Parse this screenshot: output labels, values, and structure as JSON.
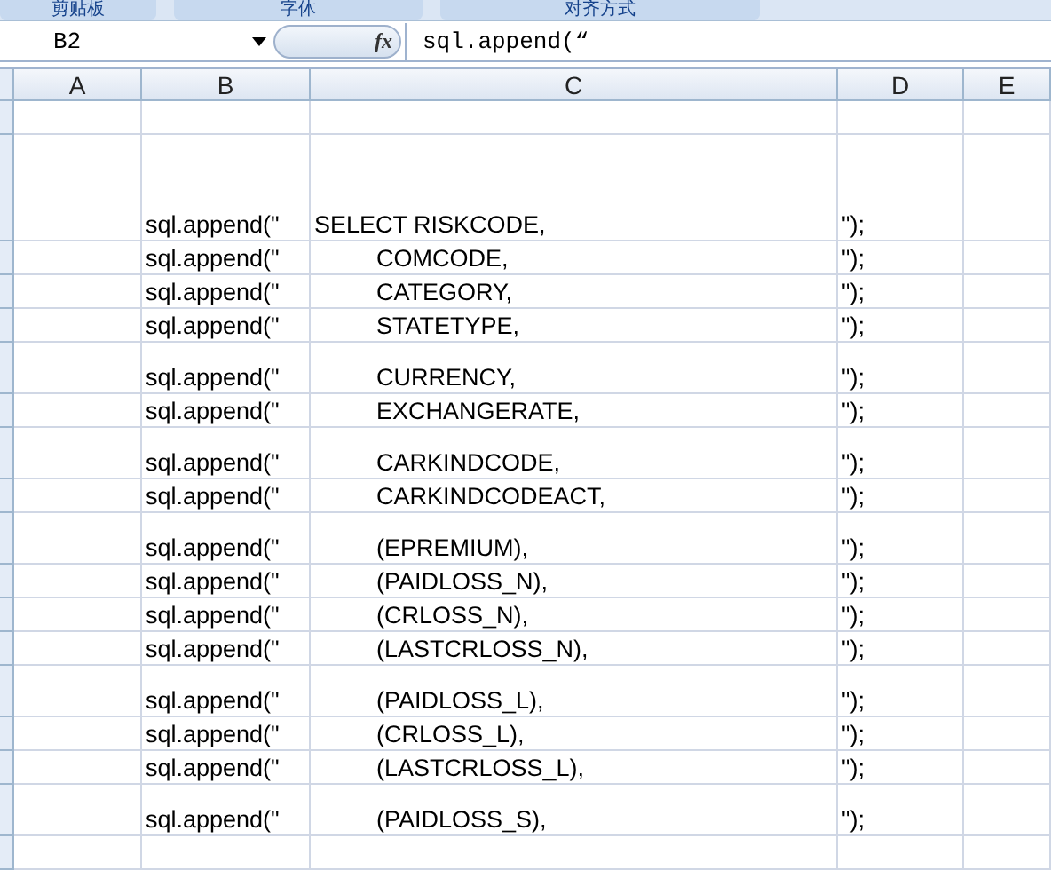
{
  "ribbon_groups": [
    "剪贴板",
    "字体",
    "对齐方式"
  ],
  "formula_bar": {
    "name_box": "B2",
    "fx": "fx",
    "formula": "sql.append(“"
  },
  "columns": [
    "A",
    "B",
    "C",
    "D",
    "E"
  ],
  "rows": [
    {
      "kind": "empty"
    },
    {
      "kind": "tall",
      "b": "sql.append(\"",
      "c": "SELECT RISKCODE,",
      "indented": false,
      "d": "\");"
    },
    {
      "kind": "plain",
      "b": "sql.append(\"",
      "c": "COMCODE,",
      "indented": true,
      "d": "\");"
    },
    {
      "kind": "plain",
      "b": "sql.append(\"",
      "c": "CATEGORY,",
      "indented": true,
      "d": "\");"
    },
    {
      "kind": "plain",
      "b": "sql.append(\"",
      "c": "STATETYPE,",
      "indented": true,
      "d": "\");"
    },
    {
      "kind": "spaced",
      "b": "sql.append(\"",
      "c": "CURRENCY,",
      "indented": true,
      "d": "\");"
    },
    {
      "kind": "plain",
      "b": "sql.append(\"",
      "c": "EXCHANGERATE,",
      "indented": true,
      "d": "\");"
    },
    {
      "kind": "spaced",
      "b": "sql.append(\"",
      "c": "CARKINDCODE,",
      "indented": true,
      "d": "\");"
    },
    {
      "kind": "plain",
      "b": "sql.append(\"",
      "c": "CARKINDCODEACT,",
      "indented": true,
      "d": "\");"
    },
    {
      "kind": "spaced",
      "b": "sql.append(\"",
      "c": "(EPREMIUM),",
      "indented": true,
      "d": "\");"
    },
    {
      "kind": "plain",
      "b": "sql.append(\"",
      "c": "(PAIDLOSS_N),",
      "indented": true,
      "d": "\");"
    },
    {
      "kind": "plain",
      "b": "sql.append(\"",
      "c": "(CRLOSS_N),",
      "indented": true,
      "d": "\");"
    },
    {
      "kind": "plain",
      "b": "sql.append(\"",
      "c": "(LASTCRLOSS_N),",
      "indented": true,
      "d": "\");"
    },
    {
      "kind": "spaced",
      "b": "sql.append(\"",
      "c": "(PAIDLOSS_L),",
      "indented": true,
      "d": "\");"
    },
    {
      "kind": "plain",
      "b": "sql.append(\"",
      "c": "(CRLOSS_L),",
      "indented": true,
      "d": "\");"
    },
    {
      "kind": "plain",
      "b": "sql.append(\"",
      "c": "(LASTCRLOSS_L),",
      "indented": true,
      "d": "\");"
    },
    {
      "kind": "spaced",
      "b": "sql.append(\"",
      "c": "(PAIDLOSS_S),",
      "indented": true,
      "d": "\");"
    },
    {
      "kind": "empty"
    }
  ]
}
